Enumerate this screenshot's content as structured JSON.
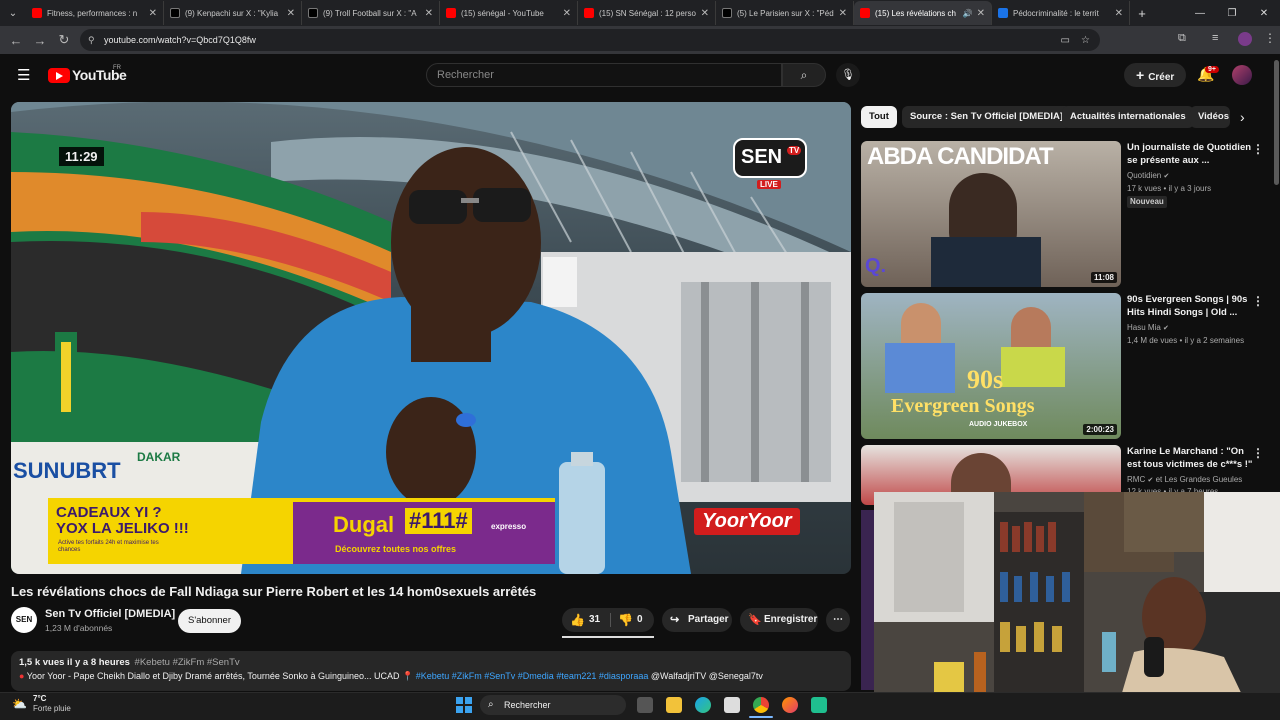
{
  "browser": {
    "tabs": [
      {
        "title": "Fitness, performances : n",
        "favicon": "youtube-icon"
      },
      {
        "title": "(9) Kenpachi sur X : \"Kylia",
        "favicon": "x-icon"
      },
      {
        "title": "(9) Troll Football sur X : \"A",
        "favicon": "x-icon"
      },
      {
        "title": "(15) sénégal - YouTube",
        "favicon": "youtube-icon"
      },
      {
        "title": "(15) SN Sénégal : 12 perso",
        "favicon": "youtube-icon"
      },
      {
        "title": "(5) Le Parisien sur X : \"Péd",
        "favicon": "x-icon"
      },
      {
        "title": "(15) Les révélations ch",
        "favicon": "youtube-icon",
        "active": true
      },
      {
        "title": "Pédocriminalité : le territ",
        "favicon": "doc-icon"
      }
    ],
    "url": "youtube.com/watch?v=Qbcd7Q1Q8fw"
  },
  "header": {
    "brand": "YouTube",
    "region": "FR",
    "search_placeholder": "Rechercher",
    "create_label": "Créer",
    "notifications_badge": "9+"
  },
  "player": {
    "overlay_time": "11:29",
    "channel_logo": "SEN",
    "channel_logo_sub": "TV",
    "live_label": "LIVE",
    "stadium_text": "SUNUBRT",
    "bus_text": "DAKAR",
    "banner_line1": "CADEAUX YI ?",
    "banner_line2": "YOX LA JELIKO !!!",
    "banner_small": "Active tes forfaits 24h et maximise tes chances",
    "banner_code_prefix": "Dugal",
    "banner_code": "#111#",
    "banner_tagline": "Découvrez toutes nos offres",
    "banner_brand": "expresso",
    "sponsor_right": "YoorYoor"
  },
  "video": {
    "title": "Les révélations chocs de Fall Ndiaga sur Pierre Robert et les 14 hom0sexuels arrêtés",
    "channel_name": "Sen Tv Officiel [DMEDIA]",
    "channel_avatar": "SEN",
    "subscribers": "1,23 M d'abonnés",
    "subscribe_label": "S'abonner",
    "likes": "31",
    "dislikes": "0",
    "share_label": "Partager",
    "save_label": "Enregistrer"
  },
  "description": {
    "stats": "1,5 k vues  il y a 8 heures",
    "tags": "#Kebetu #ZikFm #SenTv",
    "line2_text": "Yoor Yoor - Pape Cheikh Diallo et Djiby Dramé arrêtés, Tournée Sonko à Guinguineo... UCAD",
    "line2_tags": "#Kebetu #ZikFm #SenTv #Dmedia #team221 #diasporaaa",
    "line2_mentions": "@WalfadjriTV @Senegal7tv"
  },
  "chips": [
    "Tout",
    "Source : Sen Tv Officiel [DMEDIA]",
    "Actualités internationales",
    "Vidéos"
  ],
  "related": [
    {
      "title_line1": "Un journaliste de Quotidien",
      "title_line2": "se présente aux ...",
      "channel": "Quotidien",
      "meta": "17 k vues • il y a 3 jours",
      "badge": "Nouveau",
      "duration": "11:08",
      "thumb_text": "ABDA CANDIDAT",
      "thumb_logo": "Q."
    },
    {
      "title_line1": "90s Evergreen Songs | 90s",
      "title_line2": "Hits Hindi Songs | Old ...",
      "channel": "Hasu Mia",
      "meta": "1,4 M de vues • il y a 2 semaines",
      "duration": "2:00:23",
      "thumb_text1": "90s",
      "thumb_text2": "Evergreen Songs",
      "thumb_text3": "AUDIO JUKEBOX"
    },
    {
      "title_line1": "Karine Le Marchand : \"On",
      "title_line2": "est tous victimes de c***s !\"",
      "channel": "RMC",
      "channel_extra": "et Les Grandes Gueules",
      "meta": "12 k vues • il y a 7 heures"
    }
  ],
  "taskbar": {
    "temperature": "7°C",
    "weather": "Forte pluie",
    "search_label": "Rechercher"
  },
  "colors": {
    "youtube_red": "#ff0000",
    "background": "#0f0f0f",
    "banner_yellow": "#f5d400",
    "banner_purple": "#7b2a8c"
  }
}
